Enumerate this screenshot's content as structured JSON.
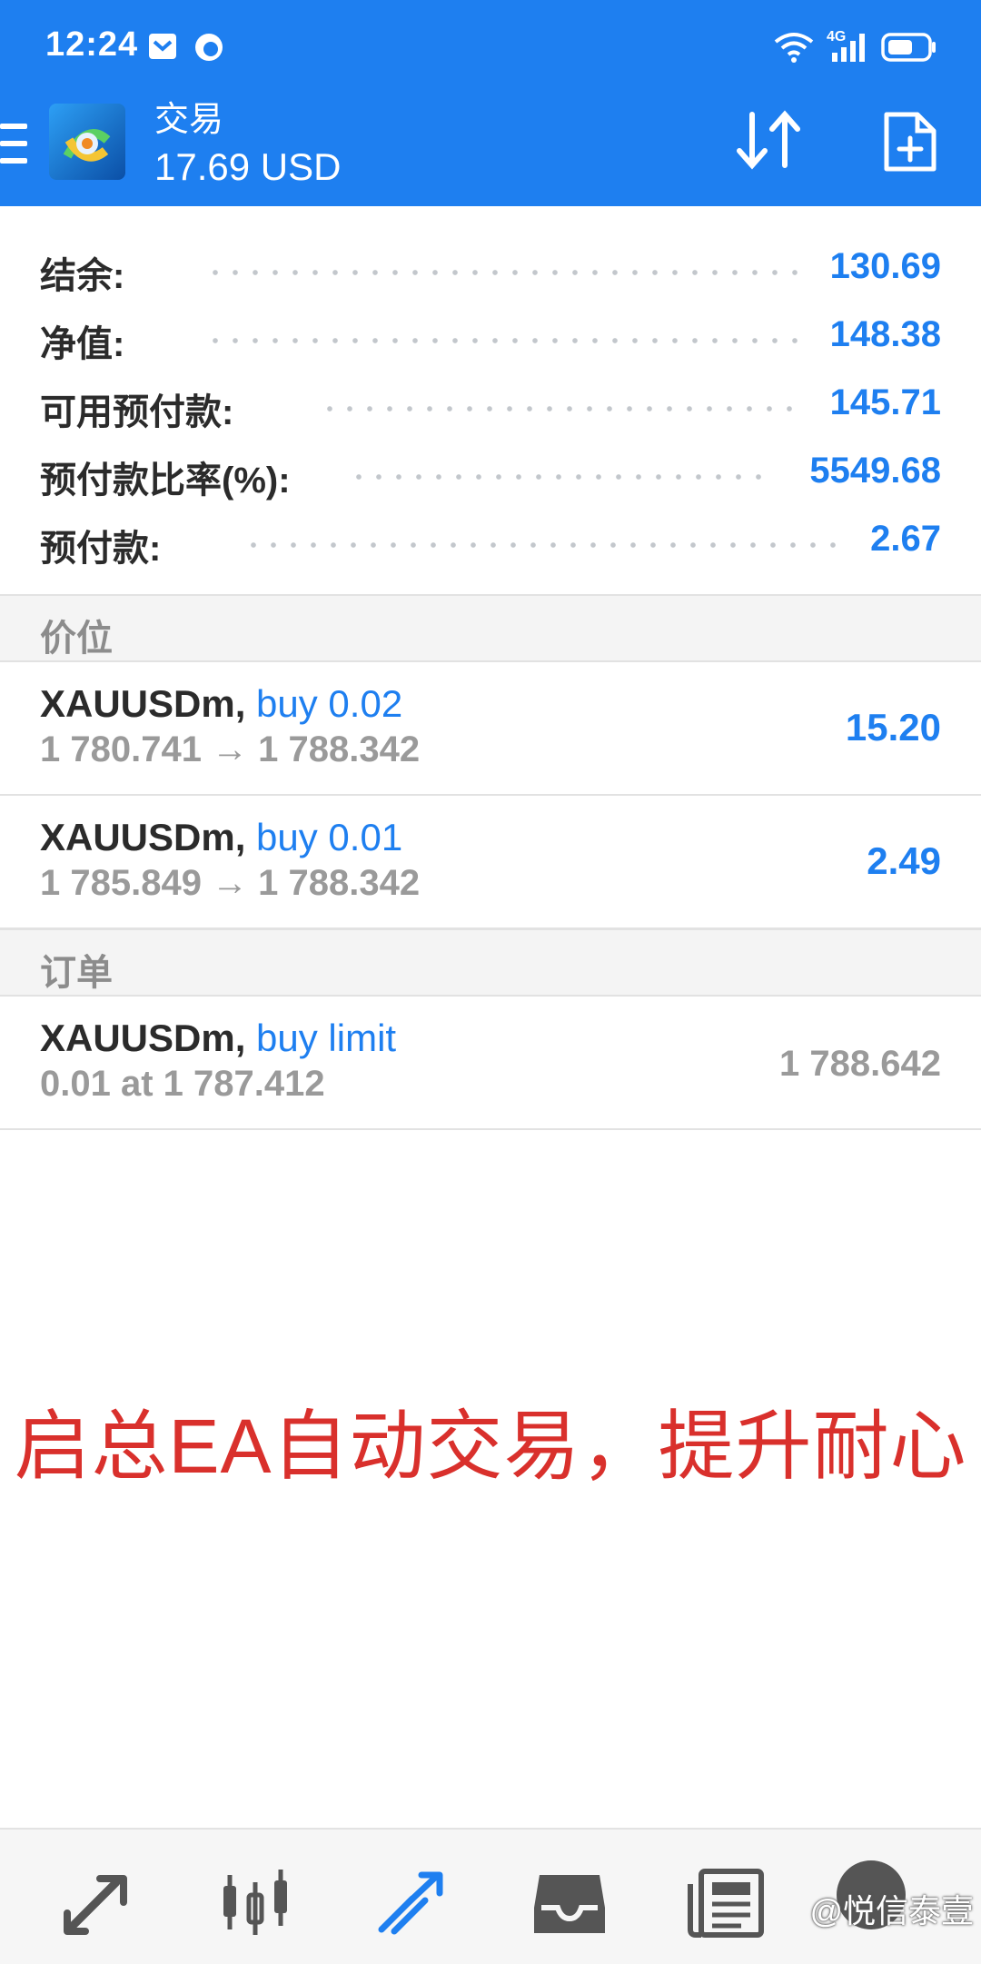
{
  "status_bar": {
    "time": "12:24",
    "network": "4G"
  },
  "header": {
    "title": "交易",
    "balance": "17.69 USD"
  },
  "summary": [
    {
      "label": "结余:",
      "value": "130.69"
    },
    {
      "label": "净值:",
      "value": "148.38"
    },
    {
      "label": "可用预付款:",
      "value": "145.71"
    },
    {
      "label": "预付款比率(%):",
      "value": "5549.68"
    },
    {
      "label": "预付款:",
      "value": "2.67"
    }
  ],
  "positions_section": {
    "title": "价位"
  },
  "positions": [
    {
      "symbol": "XAUUSDm,",
      "action": "buy 0.02",
      "prices": "1 780.741 → 1 788.342",
      "profit": "15.20"
    },
    {
      "symbol": "XAUUSDm,",
      "action": "buy 0.01",
      "prices": "1 785.849 → 1 788.342",
      "profit": "2.49"
    }
  ],
  "orders_section": {
    "title": "订单"
  },
  "orders": [
    {
      "symbol": "XAUUSDm,",
      "action": "buy limit",
      "detail": "0.01 at 1 787.412",
      "current": "1 788.642"
    }
  ],
  "banner": "启总EA自动交易，提升耐心",
  "bottom_nav": [
    {
      "icon": "quotes-icon"
    },
    {
      "icon": "chart-icon"
    },
    {
      "icon": "trade-icon"
    },
    {
      "icon": "history-icon"
    },
    {
      "icon": "news-icon"
    },
    {
      "icon": "community-icon"
    }
  ],
  "watermark": "@悦信泰壹",
  "colors": {
    "accent": "#1e7ff0",
    "banner": "#d9302c"
  }
}
